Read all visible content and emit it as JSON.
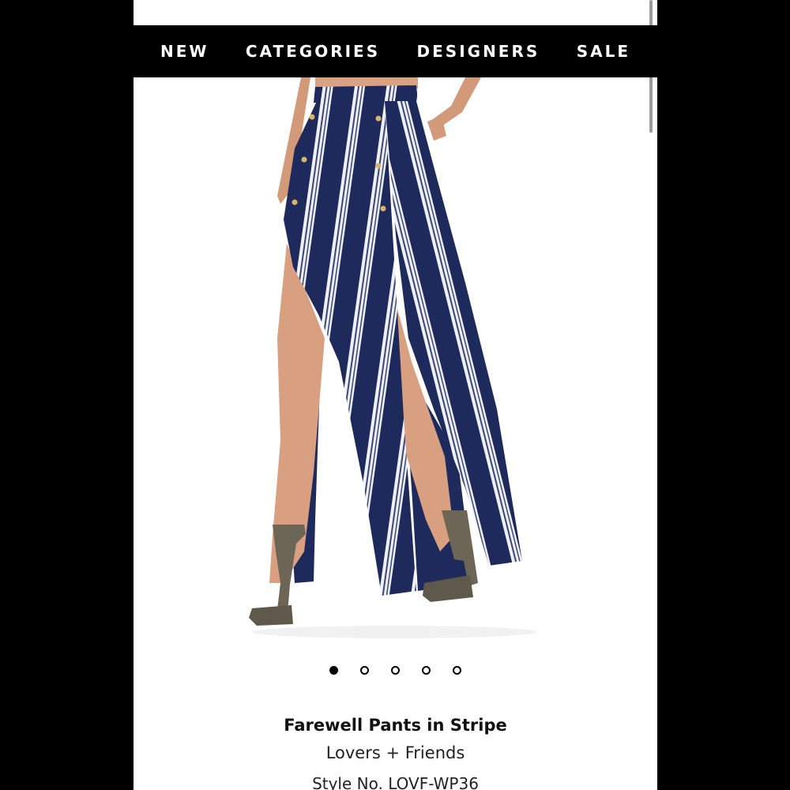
{
  "nav": {
    "items": [
      "NEW",
      "CATEGORIES",
      "DESIGNERS",
      "SALE"
    ]
  },
  "carousel": {
    "total": 5,
    "active_index": 0
  },
  "product": {
    "title": "Farewell Pants in Stripe",
    "brand": "Lovers + Friends",
    "style": "Style No. LOVF-WP36"
  },
  "colors": {
    "navy": "#1f2a5c",
    "stripe_white": "#eef0f5",
    "skin": "#d9a282",
    "heel": "#6d6657"
  }
}
